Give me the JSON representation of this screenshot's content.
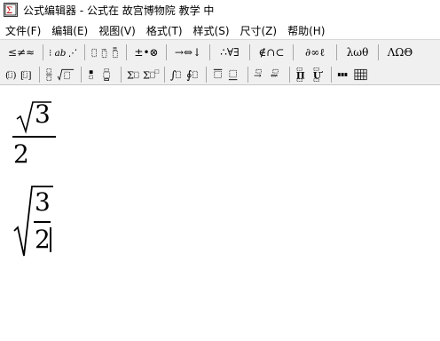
{
  "window": {
    "title": "公式编辑器 - 公式在 故宫博物院 教学 中"
  },
  "menu": {
    "items": [
      {
        "name": "menu-file",
        "label": "文件(F)"
      },
      {
        "name": "menu-edit",
        "label": "编辑(E)"
      },
      {
        "name": "menu-view",
        "label": "视图(V)"
      },
      {
        "name": "menu-format",
        "label": "格式(T)"
      },
      {
        "name": "menu-style",
        "label": "样式(S)"
      },
      {
        "name": "menu-size",
        "label": "尺寸(Z)"
      },
      {
        "name": "menu-help",
        "label": "帮助(H)"
      }
    ]
  },
  "toolbar": {
    "row1": {
      "relations": "≤≠≈",
      "operators": "±•⊗",
      "arrows": "→⇔↓",
      "logic": "∴∀∃",
      "sets": "∉∩⊂",
      "misc": "∂∞ℓ",
      "greek_lower": "λωθ",
      "greek_upper": "ΛΩΘ"
    }
  },
  "equations": {
    "eq1": {
      "radicand": "3",
      "denominator": "2"
    },
    "eq2": {
      "numerator": "3",
      "denominator": "2"
    }
  }
}
